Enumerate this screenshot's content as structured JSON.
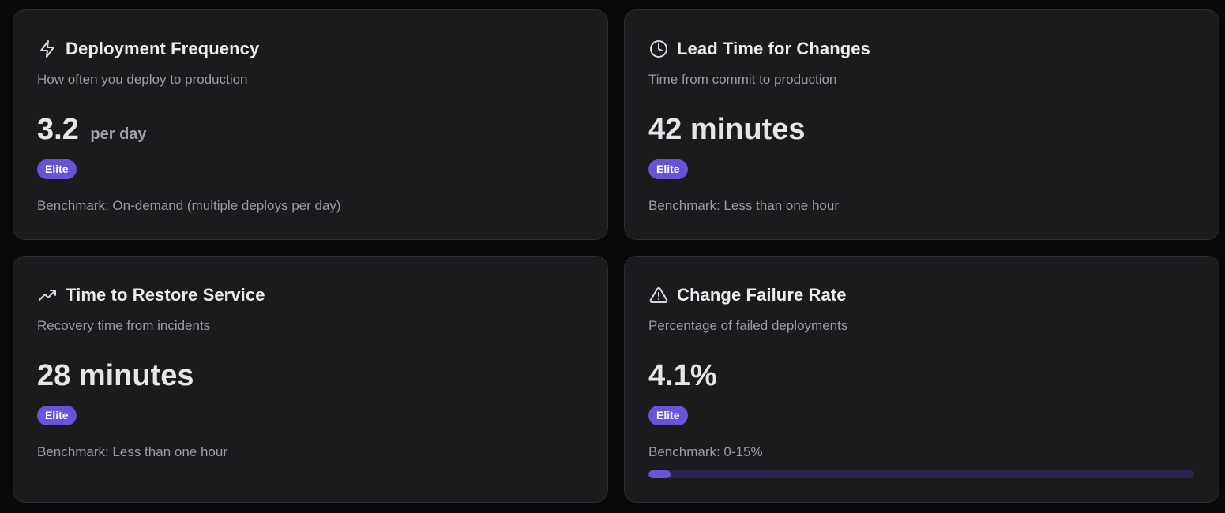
{
  "colors": {
    "background": "#09090b",
    "card": "#1b1b1e",
    "accent": "#6654d9",
    "track": "#2a2650"
  },
  "cards": [
    {
      "icon": "lightning-icon",
      "title": "Deployment Frequency",
      "subtitle": "How often you deploy to production",
      "value": "3.2",
      "unit": "per day",
      "badge": "Elite",
      "benchmark": "Benchmark: On-demand (multiple deploys per day)"
    },
    {
      "icon": "clock-icon",
      "title": "Lead Time for Changes",
      "subtitle": "Time from commit to production",
      "value": "42 minutes",
      "badge": "Elite",
      "benchmark": "Benchmark: Less than one hour"
    },
    {
      "icon": "trending-up-icon",
      "title": "Time to Restore Service",
      "subtitle": "Recovery time from incidents",
      "value": "28 minutes",
      "badge": "Elite",
      "benchmark": "Benchmark: Less than one hour"
    },
    {
      "icon": "warning-triangle-icon",
      "title": "Change Failure Rate",
      "subtitle": "Percentage of failed deployments",
      "value": "4.1%",
      "badge": "Elite",
      "benchmark": "Benchmark: 0-15%",
      "progress_fraction": 0.041
    }
  ]
}
